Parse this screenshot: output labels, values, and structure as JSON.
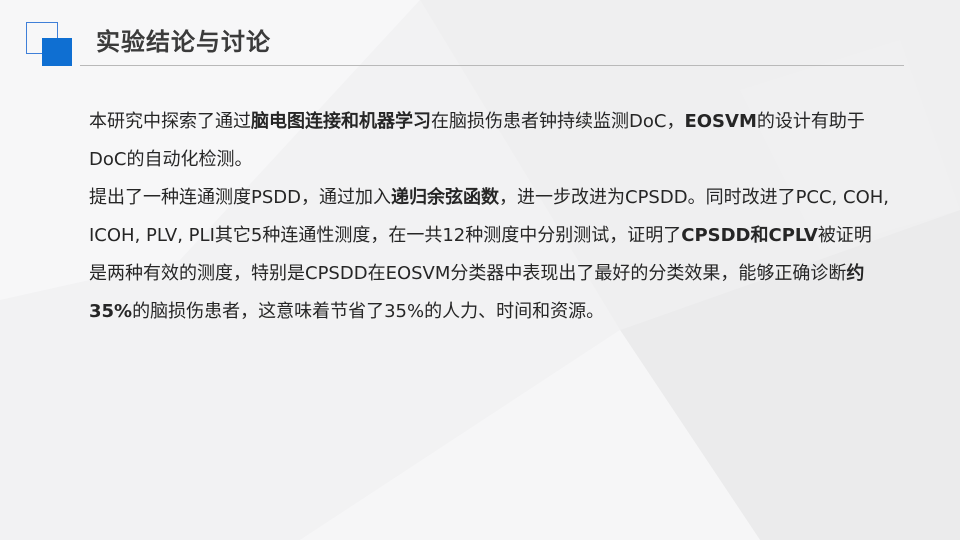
{
  "slide": {
    "title": "实验结论与讨论",
    "colors": {
      "accent": "#0f6fd2",
      "accent_outline": "#3f7fd8",
      "title_text": "#3b3b3b",
      "body_text": "#262626",
      "rule": "#b9b9b9"
    }
  },
  "body": {
    "p1": {
      "s1": "本研究中探索了通过",
      "b1": "脑电图连接和机器学习",
      "s2": "在脑损伤患者钟持续监测DoC，",
      "b2": "EOSVM",
      "s3": "的设计有助于DoC的自动化检测。"
    },
    "p2": {
      "s1": "提出了一种连通测度PSDD，通过加入",
      "b1": "递归余弦函数",
      "s2": "，进一步改进为CPSDD。同时改进了PCC, COH, ICOH, PLV, PLI其它5种连通性测度，在一共12种测度中分别测试，证明了",
      "b2": "CPSDD和CPLV",
      "s3": "被证明是两种有效的测度，特别是CPSDD在EOSVM分类器中表现出了最好的分类效果，能够正确诊断",
      "b3": "约35%",
      "s4": "的脑损伤患者，这意味着节省了35%的人力、时间和资源。"
    }
  }
}
